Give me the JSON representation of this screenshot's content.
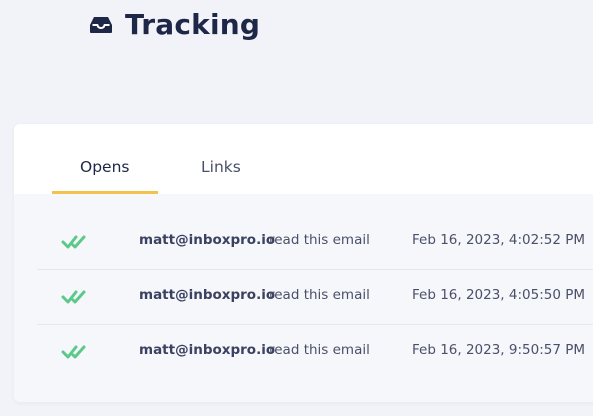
{
  "header": {
    "title": "Tracking",
    "icon": "inbox-tray-icon"
  },
  "tabs": [
    {
      "label": "Opens",
      "active": true
    },
    {
      "label": "Links",
      "active": false
    }
  ],
  "colors": {
    "title": "#1e2747",
    "tab_underline": "#f2c14e",
    "check": "#5cc98a",
    "page_background": "#f1f3f8"
  },
  "opens": [
    {
      "email": "matt@inboxpro.io",
      "action": "read this email",
      "timestamp": "Feb 16, 2023, 4:02:52 PM",
      "icon": "double-check-icon"
    },
    {
      "email": "matt@inboxpro.io",
      "action": "read this email",
      "timestamp": "Feb 16, 2023, 4:05:50 PM",
      "icon": "double-check-icon"
    },
    {
      "email": "matt@inboxpro.io",
      "action": "read this email",
      "timestamp": "Feb 16, 2023, 9:50:57 PM",
      "icon": "double-check-icon"
    }
  ]
}
